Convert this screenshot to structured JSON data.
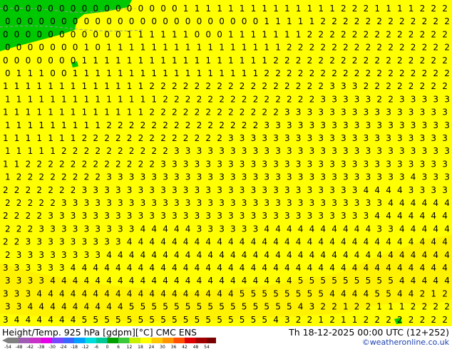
{
  "footer": {
    "title": "Height/Temp. 925 hPa [gdpm][°C] CMC ENS",
    "datetime": "Th 18-12-2025 00:00 UTC (12+252)",
    "credit": "©weatheronline.co.uk"
  },
  "colors": {
    "yellow": "#ffff00",
    "yellow_orange": "#ffef00",
    "green": "#00c800",
    "text": "#000000"
  },
  "legend": {
    "ticks": [
      "-54",
      "-48",
      "-42",
      "-38",
      "-30",
      "-24",
      "-18",
      "-12",
      "-6",
      "0",
      "6",
      "12",
      "18",
      "24",
      "30",
      "36",
      "42",
      "48",
      "54"
    ],
    "colors": [
      "#808080",
      "#a05ab4",
      "#c832c8",
      "#e600e6",
      "#7846ff",
      "#3c64ff",
      "#00a0ff",
      "#00dcdc",
      "#00c896",
      "#00a000",
      "#3cc83c",
      "#c8f000",
      "#ffff00",
      "#ffc800",
      "#ff9600",
      "#ff5000",
      "#dc0000",
      "#a00000",
      "#780000"
    ]
  },
  "grid_rows": [
    "0 0 0 0 0 0 0 0 0 0 0 0 0 0 0 0 1 1 1 1 1 1 1 1 1 1 1 1 1 1 2 2 2 1 1 1 1 2 2 2",
    "0 0 0 0 0 0 0 0 0 0 0 0 0 0 0 0 0 0 0 0 0 0 0 1 1 1 1 1 2 2 2 2 2 2 2 2 2 2 2 2",
    "0 0 0 0 0 0 0 0 0 0 0 1 1 1 1 1 1 0 0 0 1 1 1 1 1 1 1 2 2 2 2 2 2 2 2 2 2 2 2 2",
    "0 0 0 0 0 0 0 1 0 1 1 1 1 1 1 1 1 1 1 1 1 1 1 1 1 2 2 2 2 2 2 2 2 2 2 2 2 2 2 2",
    "0 0 0 0 0 0 0 1 1 1 1 1 1 1 1 1 1 1 1 1 1 1 1 1 2 2 2 2 2 2 2 2 2 2 2 2 2 2 2 2",
    "0 1 1 1 0 0 1 1 1 1 1 1 1 1 1 1 1 1 1 1 1 1 1 2 2 2 2 2 2 2 2 2 2 2 2 2 2 2 2 2",
    "1 1 1 1 1 1 1 1 1 1 1 1 1 2 2 2 2 2 2 2 2 2 2 2 2 2 2 2 2 3 3 3 2 2 2 2 2 2 2 2",
    "1 1 1 1 1 1 1 1 1 1 1 1 1 1 2 2 2 2 2 2 2 2 2 2 2 2 2 2 3 3 3 3 3 2 2 3 3 3 3 3",
    "1 1 1 1 1 1 1 1 1 1 1 1 1 2 2 2 2 2 2 2 2 2 2 2 2 3 3 3 3 3 3 3 3 3 3 3 3 3 3 3",
    "1 1 1 1 1 1 1 1 1 2 2 2 2 2 2 2 2 2 2 2 2 2 2 3 3 3 3 3 3 3 3 3 3 3 3 3 3 3 3 3",
    "1 1 1 1 1 1 1 2 2 2 2 2 2 2 2 2 2 2 2 2 3 3 3 3 3 3 3 3 3 3 3 3 3 3 3 3 3 3 3 3",
    "1 1 1 1 1 2 2 2 2 2 2 2 2 2 2 3 3 3 3 3 3 3 3 3 3 3 3 3 3 3 3 3 3 3 3 3 3 3 3 3",
    "1 1 2 2 2 2 2 2 2 2 2 2 2 2 3 3 3 3 3 3 3 3 3 3 3 3 3 3 3 3 3 3 3 3 3 3 3 3 3 3",
    "1 2 2 2 2 2 2 2 2 3 3 3 3 3 3 3 3 3 3 3 3 3 3 3 3 3 3 3 3 3 3 3 3 3 3 3 4 3 3 3",
    "2 2 2 2 2 2 2 3 3 3 3 3 3 3 3 3 3 3 3 3 3 3 3 3 3 3 3 3 3 3 3 3 4 4 4 4 3 3 3 3",
    "2 2 2 2 2 3 3 3 3 3 3 3 3 3 3 3 3 3 3 3 3 3 3 3 3 3 3 3 3 3 3 3 3 3 4 4 4 4 4 4",
    "2 2 2 2 3 3 3 3 3 3 3 3 3 3 3 3 3 3 3 3 3 3 3 3 3 3 3 3 3 3 3 3 3 4 4 4 4 4 4 4",
    "2 2 2 3 3 3 3 3 3 3 3 3 4 4 4 4 4 3 3 3 3 3 3 4 4 4 4 4 4 4 4 4 4 3 3 4 4 4 4 4",
    "2 2 3 3 3 3 3 3 3 3 3 4 4 4 4 4 4 4 4 4 4 4 4 4 4 4 4 4 4 4 4 4 4 4 4 4 4 4 4 4",
    "2 3 3 3 3 3 3 3 3 4 4 4 4 4 4 4 4 4 4 4 4 4 4 4 4 4 4 4 4 4 4 4 4 4 4 4 4 4 4 4",
    "3 3 3 3 3 3 4 4 4 4 4 4 4 4 4 4 4 4 4 4 4 4 4 4 4 4 4 4 4 4 4 4 4 4 4 4 4 4 4 4",
    "3 3 3 3 4 4 4 4 4 4 4 4 4 4 4 4 4 4 4 4 4 4 4 4 4 4 5 5 5 5 5 5 5 5 5 4 4 4 4 4",
    "3 3 3 4 4 4 4 4 4 4 4 4 4 4 4 4 4 4 4 4 4 5 5 5 5 5 5 5 5 4 4 4 4 5 5 4 4 2 1 2",
    "3 3 4 4 4 4 4 4 4 4 4 5 5 5 5 5 5 5 5 5 5 5 5 5 5 5 4 3 2 2 1 2 2 1 1 1 2 2 2 2",
    "3 4 4 4 4 4 4 5 5 5 5 5 5 5 5 5 5 5 5 5 5 5 5 5 4 3 2 2 1 2 1 1 2 2 2 2 2 2 2 2"
  ]
}
